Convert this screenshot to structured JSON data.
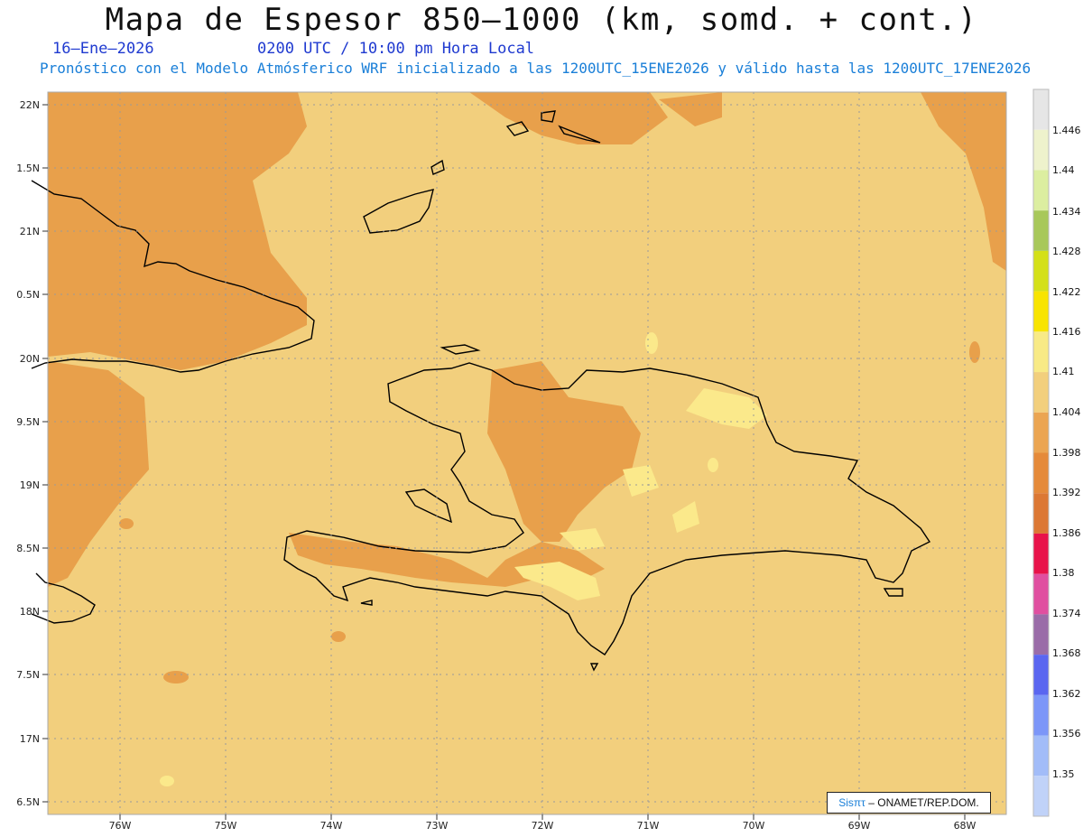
{
  "header": {
    "title": "Mapa de Espesor 850—1000 (km, somd. + cont.)",
    "date": "16–Ene—2026",
    "time": "0200 UTC / 10:00 pm Hora Local",
    "subtitle": "Pronóstico con el Modelo Atmósferico WRF inicializado a las 1200UTC_15ENE2026 y válido hasta las  1200UTC_17ENE2026"
  },
  "map": {
    "lat_labels": [
      "22N",
      "1.5N",
      "21N",
      "0.5N",
      "20N",
      "9.5N",
      "19N",
      "8.5N",
      "18N",
      "7.5N",
      "17N",
      "6.5N"
    ],
    "lon_labels": [
      "76W",
      "75W",
      "74W",
      "73W",
      "72W",
      "71W",
      "70W",
      "69W",
      "68W"
    ],
    "base_color": "#f2cf7d",
    "dark_color": "#e8a04b",
    "light_color": "#fbe98b",
    "coast_color": "#000000",
    "grid": "dotted"
  },
  "colorbar": {
    "labels": [
      "1.446",
      "1.44",
      "1.434",
      "1.428",
      "1.422",
      "1.416",
      "1.41",
      "1.404",
      "1.398",
      "1.392",
      "1.386",
      "1.38",
      "1.374",
      "1.368",
      "1.362",
      "1.356",
      "1.35"
    ],
    "colors": [
      "#e6e6e6",
      "#eef2cc",
      "#dceea0",
      "#a8c85a",
      "#d4e018",
      "#f8e400",
      "#f8ea86",
      "#f2cf7d",
      "#eba552",
      "#e58a3a",
      "#dc7834",
      "#e8134a",
      "#e04fa0",
      "#9a6ca8",
      "#5a66f0",
      "#7c96f8",
      "#a2bcf8",
      "#c0d2f8"
    ]
  },
  "credit": {
    "brand": "Sisπτ",
    "text": "– ONAMET/REP.DOM."
  }
}
